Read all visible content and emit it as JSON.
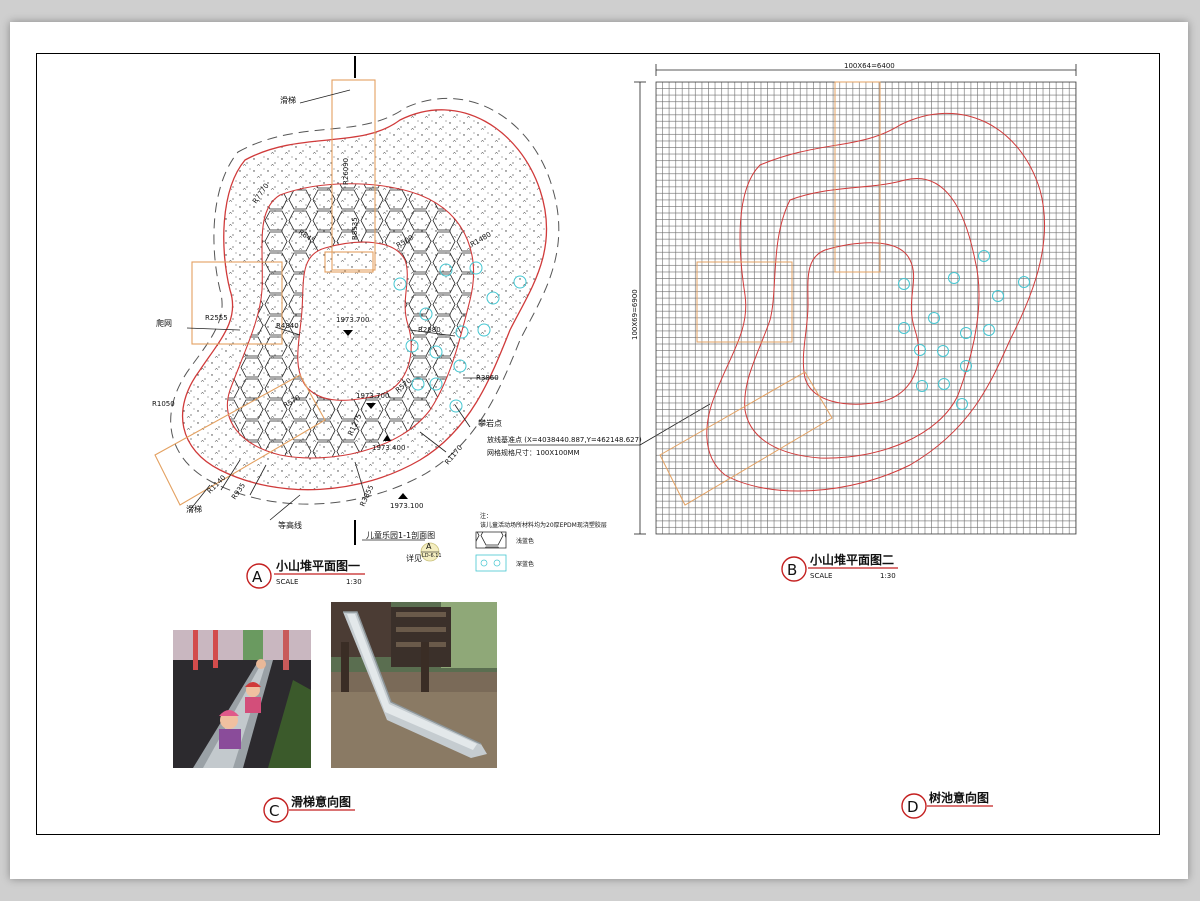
{
  "colors": {
    "red_line": "#d03a3a",
    "orange_line": "#e3a060",
    "cyan_marker": "#45c6d1",
    "grid_gray": "#6b6b6b",
    "ink": "#111111"
  },
  "plan_a": {
    "labels": {
      "slide_top": "滑梯",
      "climb_net": "爬网",
      "slide_bottom": "滑梯",
      "contour": "等高线",
      "climb_point": "攀岩点",
      "section_ref": "儿童乐园1-1剖面图",
      "see_ref": "详见",
      "detail_no": "LD-6.11",
      "detail_letter": "A"
    },
    "radii": {
      "r7770": "R7770",
      "r26090": "R26090",
      "r8535": "R8535",
      "r845": "R845",
      "r500": "R500",
      "r1480": "R1480",
      "r2555": "R2555",
      "r4340": "R4340",
      "r2880": "R2880",
      "r3860": "R3860",
      "r570": "R570",
      "r1050": "R1050",
      "r570b": "R570",
      "r1275": "R1275",
      "r1170": "R1170",
      "r1140": "R1140",
      "r935": "R935",
      "r3855": "R3855"
    },
    "elevations": {
      "e1": "1973.700",
      "e2": "1973.700",
      "e3": "1973.400",
      "e4": "1973.100"
    },
    "notes": {
      "baseline": "放线基准点 (X=4038440.887,Y=462148.627)",
      "grid_size": "网格规格尺寸：100X100MM",
      "note_head": "注：",
      "note_body": "该儿童活动场所材料均为20厚EPDM现浇塑胶层",
      "legend_light": "浅蓝色",
      "legend_dark": "深蓝色"
    },
    "title": {
      "letter": "A",
      "name": "小山堆平面图一",
      "scale_label": "SCALE",
      "scale_value": "1:30"
    }
  },
  "plan_b": {
    "dim_top": "100X64=6400",
    "dim_left": "100X69=6900",
    "title": {
      "letter": "B",
      "name": "小山堆平面图二",
      "scale_label": "SCALE",
      "scale_value": "1:30"
    }
  },
  "title_c": {
    "letter": "C",
    "name": "滑梯意向图"
  },
  "title_d": {
    "letter": "D",
    "name": "树池意向图"
  }
}
